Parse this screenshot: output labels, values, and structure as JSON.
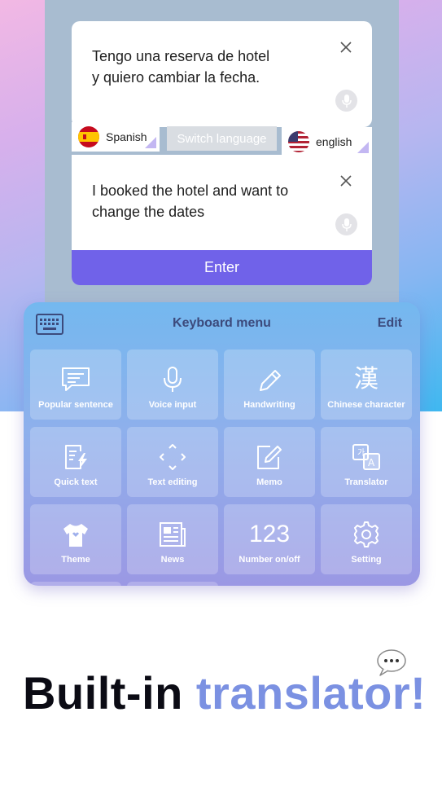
{
  "translator": {
    "source_text_line1": "Tengo una reserva de hotel",
    "source_text_line2": "y quiero cambiar la fecha.",
    "target_text_line1": "I booked the hotel and want to",
    "target_text_line2": "change the dates",
    "source_language": "Spanish",
    "target_language": "english",
    "switch_label": "Switch language",
    "enter_label": "Enter"
  },
  "keyboard_menu": {
    "title": "Keyboard menu",
    "edit_label": "Edit",
    "items": [
      {
        "label": "Popular sentence",
        "icon": "chat-lines-icon"
      },
      {
        "label": "Voice input",
        "icon": "microphone-icon"
      },
      {
        "label": "Handwriting",
        "icon": "pencil-icon"
      },
      {
        "label": "Chinese character",
        "icon": "chinese-character-icon",
        "glyph": "漢"
      },
      {
        "label": "Quick text",
        "icon": "quick-text-icon"
      },
      {
        "label": "Text editing",
        "icon": "move-arrows-icon"
      },
      {
        "label": "Memo",
        "icon": "memo-edit-icon"
      },
      {
        "label": "Translator",
        "icon": "translate-icon"
      },
      {
        "label": "Theme",
        "icon": "tshirt-icon"
      },
      {
        "label": "News",
        "icon": "newspaper-icon"
      },
      {
        "label": "Number on/off",
        "icon": "number-icon",
        "glyph": "123"
      },
      {
        "label": "Setting",
        "icon": "gear-icon"
      }
    ]
  },
  "headline": {
    "part1": "Built-in ",
    "part2": "translator!"
  },
  "colors": {
    "accent_purple": "#7062e9",
    "headline_accent": "#7b91e2"
  }
}
